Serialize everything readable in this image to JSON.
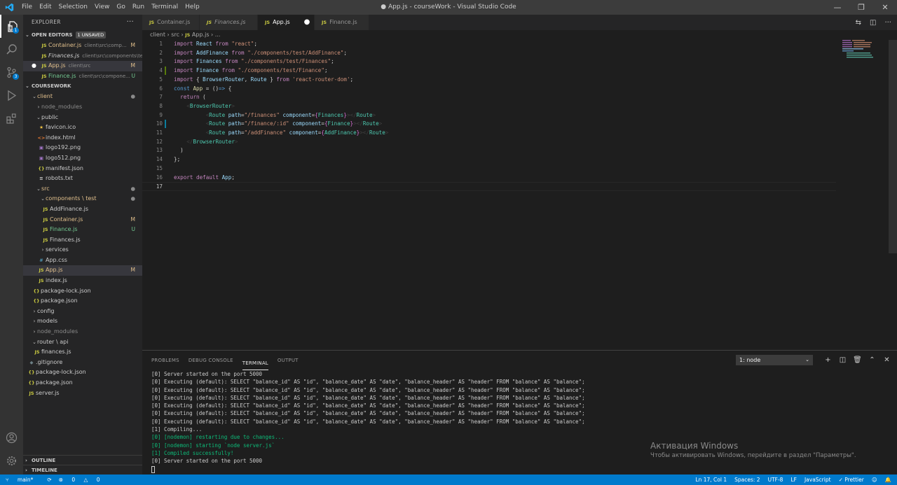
{
  "window": {
    "title": "● App.js - courseWork - Visual Studio Code",
    "menu": [
      "File",
      "Edit",
      "Selection",
      "View",
      "Go",
      "Run",
      "Terminal",
      "Help"
    ]
  },
  "activity": {
    "explorer_badge": "1",
    "scm_badge": "3"
  },
  "sidebar": {
    "header": "EXPLORER",
    "open_editors_label": "OPEN EDITORS",
    "unsaved_badge": "1 UNSAVED",
    "open_editors": [
      {
        "icon": "JS",
        "name": "Container.js",
        "path": "client\\src\\comp...",
        "status": "M"
      },
      {
        "icon": "JS",
        "name": "Finances.js",
        "path": "client\\src\\components\\test",
        "status": ""
      },
      {
        "icon": "JS",
        "name": "App.js",
        "path": "client\\src",
        "status": "M"
      },
      {
        "icon": "JS",
        "name": "Finance.js",
        "path": "client\\src\\compone...",
        "status": "U"
      }
    ],
    "project_label": "COURSEWORK",
    "tree": {
      "client": "client",
      "node_modules": "node_modules",
      "public": "public",
      "favicon": "favicon.ico",
      "index_html": "index.html",
      "logo192": "logo192.png",
      "logo512": "logo512.png",
      "manifest": "manifest.json",
      "robots": "robots.txt",
      "src": "src",
      "components": "components \\ test",
      "addfinance": "AddFinance.js",
      "container": "Container.js",
      "finance": "Finance.js",
      "finances": "Finances.js",
      "services": "services",
      "app_css": "App.css",
      "app_js": "App.js",
      "index_js": "index.js",
      "package_lock": "package-lock.json",
      "package_json": "package.json",
      "config": "config",
      "models": "models",
      "node_modules2": "node_modules",
      "router": "router \\ api",
      "finances_router": "finances.js",
      "gitignore": ".gitignore",
      "package_lock2": "package-lock.json",
      "package_json2": "package.json",
      "server": "server.js"
    },
    "status_m": "M",
    "status_u": "U",
    "outline_label": "OUTLINE",
    "timeline_label": "TIMELINE"
  },
  "tabs": [
    {
      "icon": "JS",
      "label": "Container.js"
    },
    {
      "icon": "JS",
      "label": "Finances.js"
    },
    {
      "icon": "JS",
      "label": "App.js"
    },
    {
      "icon": "JS",
      "label": "Finance.js"
    }
  ],
  "breadcrumb": {
    "part1": "client",
    "part2": "src",
    "icon": "JS",
    "part3": "App.js",
    "part4": "..."
  },
  "editor": {
    "line_numbers": [
      "1",
      "2",
      "3",
      "4",
      "5",
      "6",
      "7",
      "8",
      "9",
      "10",
      "11",
      "12",
      "13",
      "14",
      "15",
      "16",
      "17"
    ],
    "current_line": "17"
  },
  "panel": {
    "tabs": [
      "PROBLEMS",
      "DEBUG CONSOLE",
      "TERMINAL",
      "OUTPUT"
    ],
    "terminal_select": "1: node",
    "terminal_lines": [
      {
        "text": "[0] Server started on the port 5000",
        "green": false
      },
      {
        "text": "[0] Executing (default): SELECT \"balance_id\" AS \"id\", \"balance_date\" AS \"date\", \"balance_header\" AS \"header\" FROM \"balance\" AS \"balance\";",
        "green": false
      },
      {
        "text": "[0] Executing (default): SELECT \"balance_id\" AS \"id\", \"balance_date\" AS \"date\", \"balance_header\" AS \"header\" FROM \"balance\" AS \"balance\";",
        "green": false
      },
      {
        "text": "[0] Executing (default): SELECT \"balance_id\" AS \"id\", \"balance_date\" AS \"date\", \"balance_header\" AS \"header\" FROM \"balance\" AS \"balance\";",
        "green": false
      },
      {
        "text": "[0] Executing (default): SELECT \"balance_id\" AS \"id\", \"balance_date\" AS \"date\", \"balance_header\" AS \"header\" FROM \"balance\" AS \"balance\";",
        "green": false
      },
      {
        "text": "[0] Executing (default): SELECT \"balance_id\" AS \"id\", \"balance_date\" AS \"date\", \"balance_header\" AS \"header\" FROM \"balance\" AS \"balance\";",
        "green": false
      },
      {
        "text": "[0] Executing (default): SELECT \"balance_id\" AS \"id\", \"balance_date\" AS \"date\", \"balance_header\" AS \"header\" FROM \"balance\" AS \"balance\";",
        "green": false
      },
      {
        "text": "[1] Compiling...",
        "green": false
      },
      {
        "text": "[0] [nodemon] restarting due to changes...",
        "green": true
      },
      {
        "text": "[0] [nodemon] starting `node server.js`",
        "green": true
      },
      {
        "text": "[1] Compiled successfully!",
        "green": true
      },
      {
        "text": "[0] Server started on the port 5000",
        "green": false
      }
    ]
  },
  "activation": {
    "title": "Активация Windows",
    "subtitle": "Чтобы активировать Windows, перейдите в раздел \"Параметры\"."
  },
  "statusbar": {
    "branch": "main*",
    "errors": "0",
    "warnings": "0",
    "position": "Ln 17, Col 1",
    "spaces": "Spaces: 2",
    "encoding": "UTF-8",
    "eol": "LF",
    "language": "JavaScript",
    "formatter": "✓ Prettier"
  }
}
